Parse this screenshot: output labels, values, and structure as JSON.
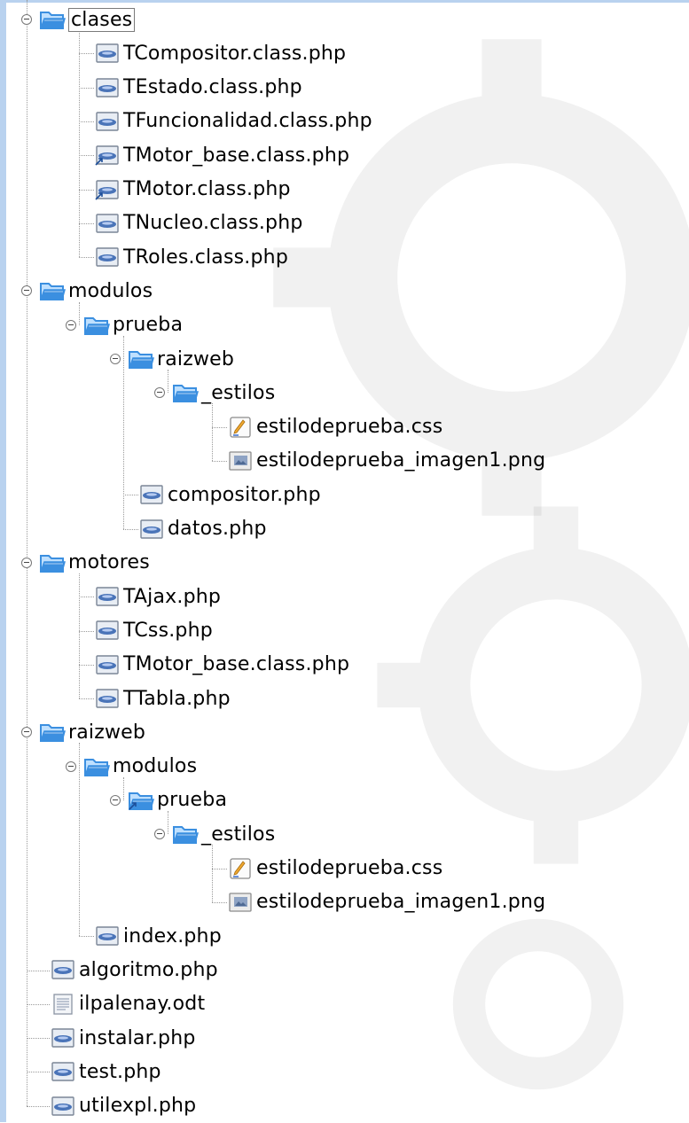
{
  "tree": {
    "items": [
      {
        "label": "clases",
        "icon": "folder-open-icon",
        "depth": 0,
        "expanded": true,
        "selected": true
      },
      {
        "label": "TCompositor.class.php",
        "icon": "php-file-icon",
        "depth": 1
      },
      {
        "label": "TEstado.class.php",
        "icon": "php-file-icon",
        "depth": 1
      },
      {
        "label": "TFuncionalidad.class.php",
        "icon": "php-file-icon",
        "depth": 1
      },
      {
        "label": "TMotor_base.class.php",
        "icon": "php-file-link-icon",
        "depth": 1
      },
      {
        "label": "TMotor.class.php",
        "icon": "php-file-link-icon",
        "depth": 1
      },
      {
        "label": "TNucleo.class.php",
        "icon": "php-file-icon",
        "depth": 1
      },
      {
        "label": "TRoles.class.php",
        "icon": "php-file-icon",
        "depth": 1
      },
      {
        "label": "modulos",
        "icon": "folder-open-icon",
        "depth": 0,
        "expanded": true
      },
      {
        "label": "prueba",
        "icon": "folder-open-icon",
        "depth": 1,
        "expanded": true
      },
      {
        "label": "raizweb",
        "icon": "folder-open-icon",
        "depth": 2,
        "expanded": true
      },
      {
        "label": "_estilos",
        "icon": "folder-open-icon",
        "depth": 3,
        "expanded": true
      },
      {
        "label": "estilodeprueba.css",
        "icon": "css-file-icon",
        "depth": 4
      },
      {
        "label": "estilodeprueba_imagen1.png",
        "icon": "image-file-icon",
        "depth": 4
      },
      {
        "label": "compositor.php",
        "icon": "php-file-icon",
        "depth": 2
      },
      {
        "label": "datos.php",
        "icon": "php-file-icon",
        "depth": 2
      },
      {
        "label": "motores",
        "icon": "folder-open-icon",
        "depth": 0,
        "expanded": true
      },
      {
        "label": "TAjax.php",
        "icon": "php-file-icon",
        "depth": 1
      },
      {
        "label": "TCss.php",
        "icon": "php-file-icon",
        "depth": 1
      },
      {
        "label": "TMotor_base.class.php",
        "icon": "php-file-icon",
        "depth": 1
      },
      {
        "label": "TTabla.php",
        "icon": "php-file-icon",
        "depth": 1
      },
      {
        "label": "raizweb",
        "icon": "folder-open-icon",
        "depth": 0,
        "expanded": true
      },
      {
        "label": "modulos",
        "icon": "folder-open-icon",
        "depth": 1,
        "expanded": true
      },
      {
        "label": "prueba",
        "icon": "folder-link-icon",
        "depth": 2,
        "expanded": true
      },
      {
        "label": "_estilos",
        "icon": "folder-open-icon",
        "depth": 3,
        "expanded": true
      },
      {
        "label": "estilodeprueba.css",
        "icon": "css-file-icon",
        "depth": 4
      },
      {
        "label": "estilodeprueba_imagen1.png",
        "icon": "image-file-icon",
        "depth": 4
      },
      {
        "label": "index.php",
        "icon": "php-file-icon",
        "depth": 1
      },
      {
        "label": "algoritmo.php",
        "icon": "php-file-icon",
        "depth": 0
      },
      {
        "label": "ilpalenay.odt",
        "icon": "document-file-icon",
        "depth": 0
      },
      {
        "label": "instalar.php",
        "icon": "php-file-icon",
        "depth": 0
      },
      {
        "label": "test.php",
        "icon": "php-file-icon",
        "depth": 0
      },
      {
        "label": "utilexpl.php",
        "icon": "php-file-icon",
        "depth": 0
      }
    ]
  },
  "colors": {
    "folder": "#3b8fe0",
    "folder_light": "#bfe0ff",
    "php_body": "#e8edf4",
    "php_badge": "#4a74b8",
    "frame": "#b9d2ef"
  }
}
